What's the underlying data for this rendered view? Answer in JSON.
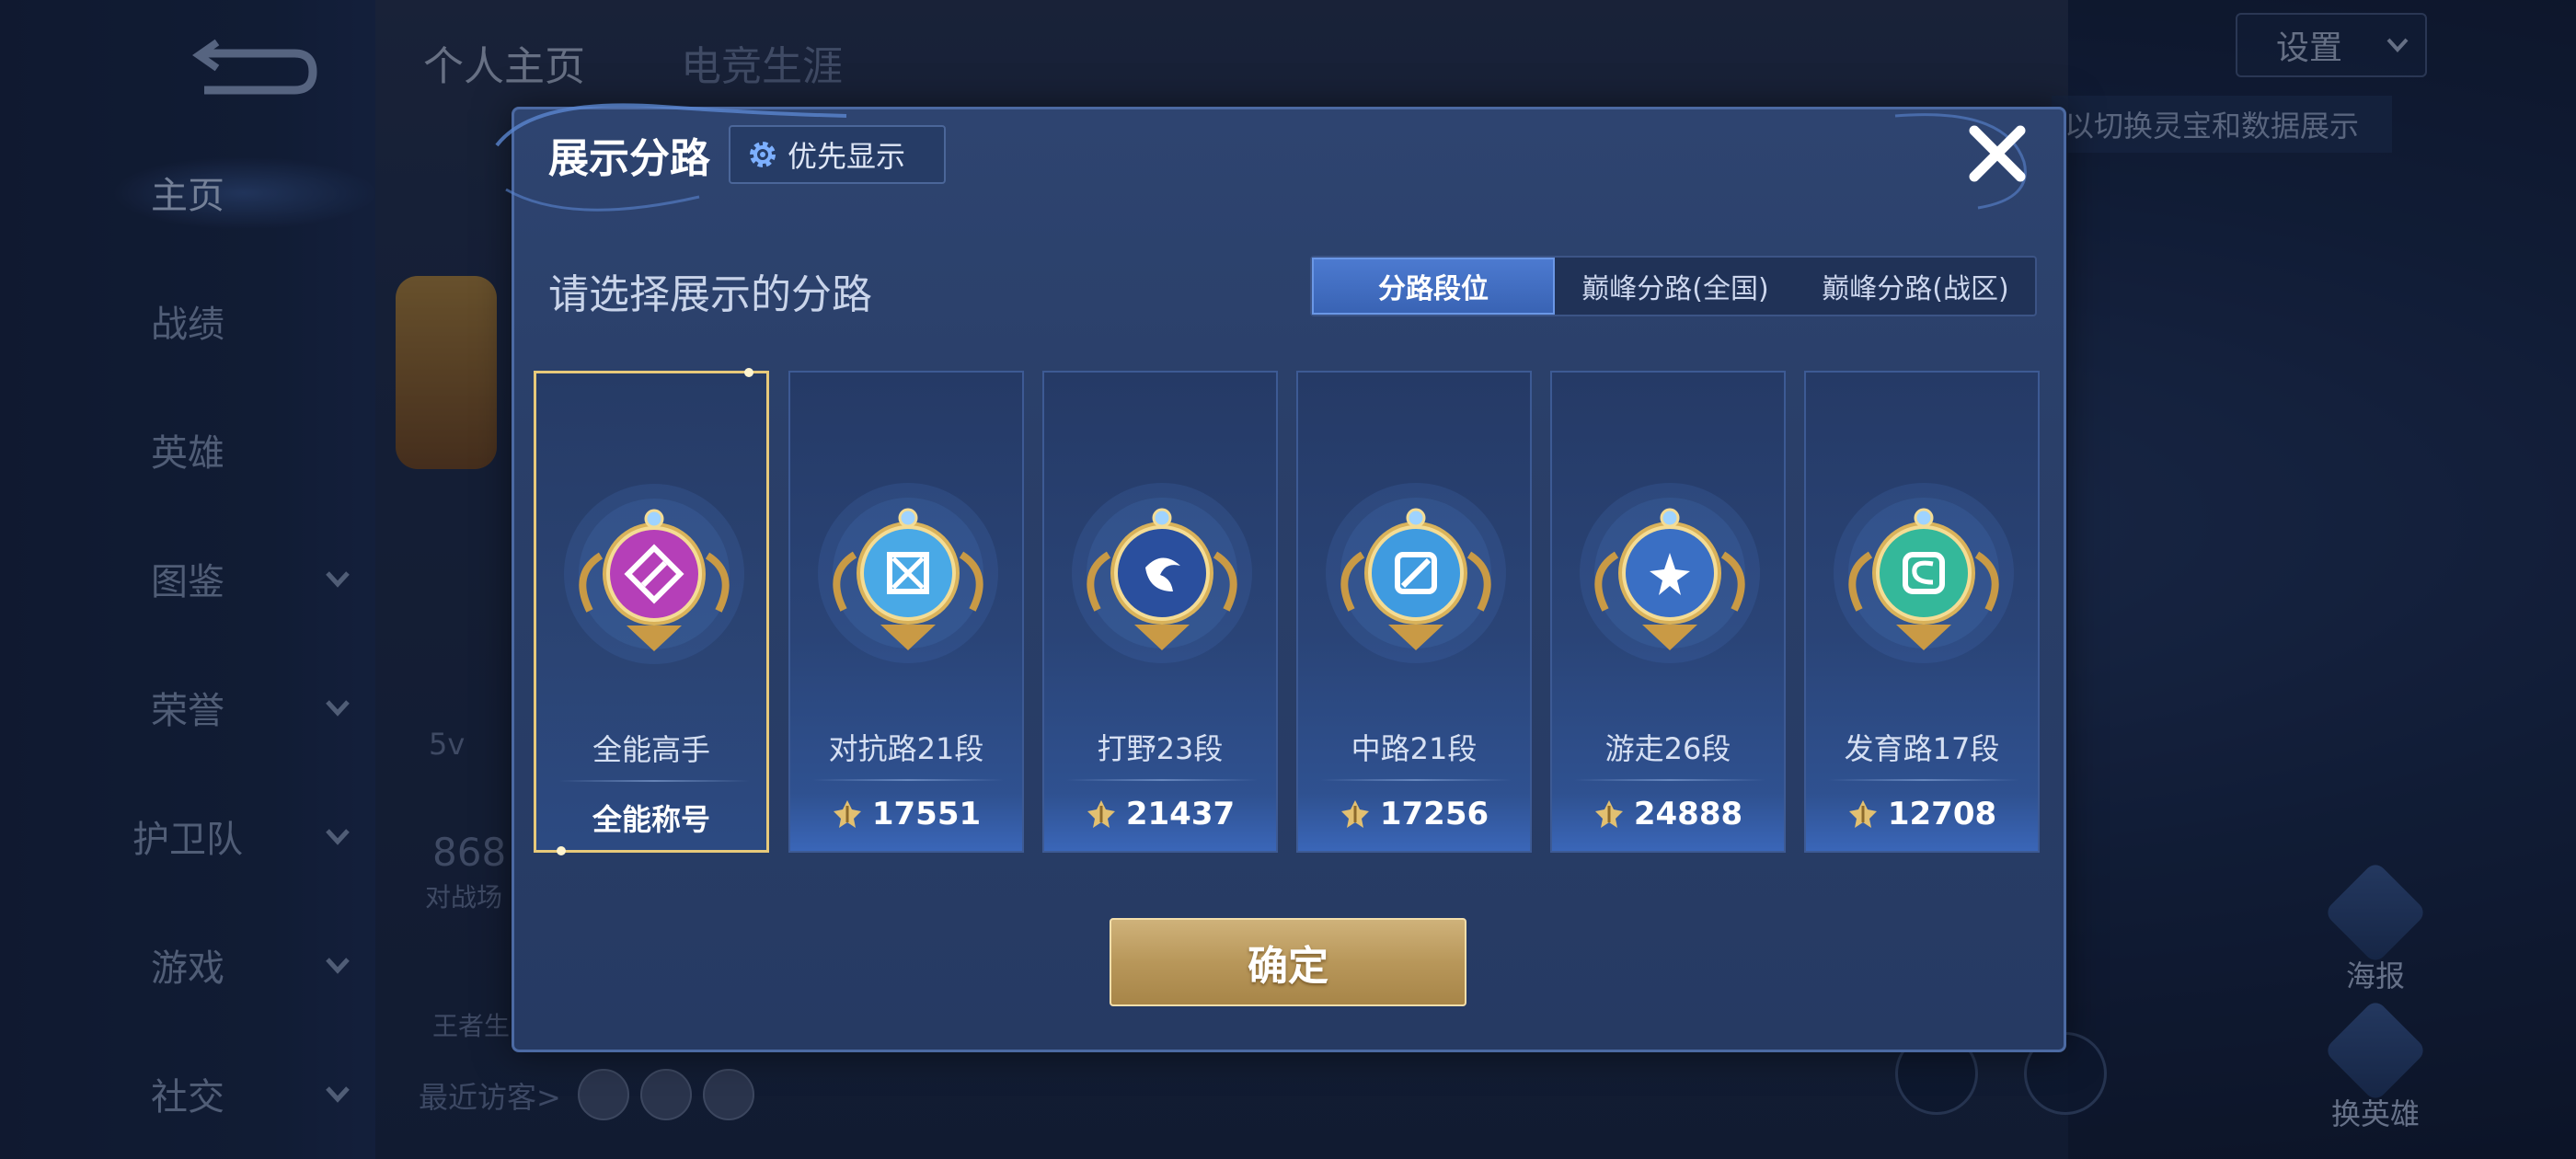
{
  "background": {
    "sidebar": {
      "items": [
        {
          "label": "主页",
          "active": true,
          "has_chevron": false
        },
        {
          "label": "战绩",
          "active": false,
          "has_chevron": false
        },
        {
          "label": "英雄",
          "active": false,
          "has_chevron": false
        },
        {
          "label": "图鉴",
          "active": false,
          "has_chevron": true
        },
        {
          "label": "荣誉",
          "active": false,
          "has_chevron": true
        },
        {
          "label": "护卫队",
          "active": false,
          "has_chevron": true
        },
        {
          "label": "游戏",
          "active": false,
          "has_chevron": true
        },
        {
          "label": "社交",
          "active": false,
          "has_chevron": true
        }
      ]
    },
    "top_tabs": [
      {
        "label": "个人主页"
      },
      {
        "label": "电竞生涯"
      }
    ],
    "settings_label": "设置",
    "hint_text": "以切换灵宝和数据展示",
    "recent_visitors_label": "最近访客>",
    "faded_texts": {
      "mode": "5v",
      "count": "868",
      "sub": "对战场",
      "king": "王者生"
    },
    "poster_label": "海报",
    "swap_hero_label": "换英雄"
  },
  "modal": {
    "title": "展示分路",
    "priority_button": "优先显示",
    "section_title": "请选择展示的分路",
    "segment_tabs": [
      {
        "label": "分路段位",
        "active": true
      },
      {
        "label": "巅峰分路(全国)",
        "active": false
      },
      {
        "label": "巅峰分路(战区)",
        "active": false
      }
    ],
    "cards": [
      {
        "name": "全能高手",
        "value": "全能称号",
        "selected": true,
        "emblem": "all-round-emblem-icon",
        "color": "#b53fb8",
        "glyph": "all"
      },
      {
        "name": "对抗路21段",
        "value": "17551",
        "selected": false,
        "emblem": "clash-lane-emblem-icon",
        "color": "#49a9e6",
        "glyph": "clash"
      },
      {
        "name": "打野23段",
        "value": "21437",
        "selected": false,
        "emblem": "jungle-emblem-icon",
        "color": "#2a4f9e",
        "glyph": "jungle"
      },
      {
        "name": "中路21段",
        "value": "17256",
        "selected": false,
        "emblem": "mid-lane-emblem-icon",
        "color": "#3f9be0",
        "glyph": "mid"
      },
      {
        "name": "游走26段",
        "value": "24888",
        "selected": false,
        "emblem": "roam-emblem-icon",
        "color": "#3a6fc4",
        "glyph": "roam"
      },
      {
        "name": "发育路17段",
        "value": "12708",
        "selected": false,
        "emblem": "farm-lane-emblem-icon",
        "color": "#34b89a",
        "glyph": "farm"
      }
    ],
    "confirm_label": "确定"
  }
}
